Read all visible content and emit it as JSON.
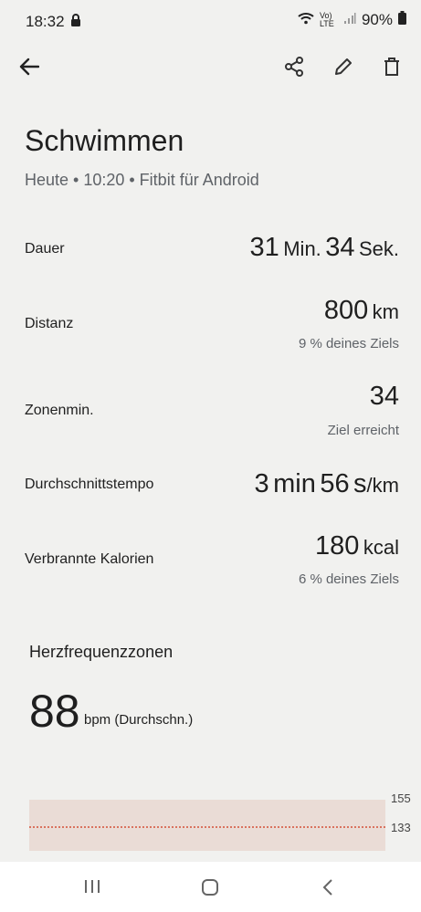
{
  "status_bar": {
    "time": "18:32",
    "battery": "90%",
    "network": "Vo) LTE"
  },
  "header": {
    "back_icon": "arrow-back-icon",
    "share_icon": "share-icon",
    "edit_icon": "edit-icon",
    "delete_icon": "delete-icon"
  },
  "activity": {
    "title": "Schwimmen",
    "subtitle": "Heute • 10:20 • Fitbit für Android"
  },
  "stats": {
    "duration": {
      "label": "Dauer",
      "v1": "31",
      "u1": "Min.",
      "v2": "34",
      "u2": "Sek."
    },
    "distance": {
      "label": "Distanz",
      "value": "800",
      "unit": "km",
      "sub": "9 % deines Ziels"
    },
    "zone": {
      "label": "Zonenmin.",
      "value": "34",
      "sub": "Ziel erreicht"
    },
    "pace": {
      "label": "Durchschnittstempo",
      "v1": "3",
      "u1": "min",
      "v2": "56",
      "u2": "s",
      "u3": "/km"
    },
    "calories": {
      "label": "Verbrannte Kalorien",
      "value": "180",
      "unit": "kcal",
      "sub": "6 % deines Ziels"
    }
  },
  "heart": {
    "section_title": "Herzfrequenzzonen",
    "value": "88",
    "unit": "bpm (Durchschn.)"
  },
  "chart": {
    "tick_top": "155",
    "tick_bottom": "133",
    "band_color": "#eadcd6",
    "line_color": "#d9735f"
  },
  "navbar": {
    "recent_icon": "recent-apps-icon",
    "home_icon": "home-icon",
    "back_icon": "nav-back-icon"
  }
}
